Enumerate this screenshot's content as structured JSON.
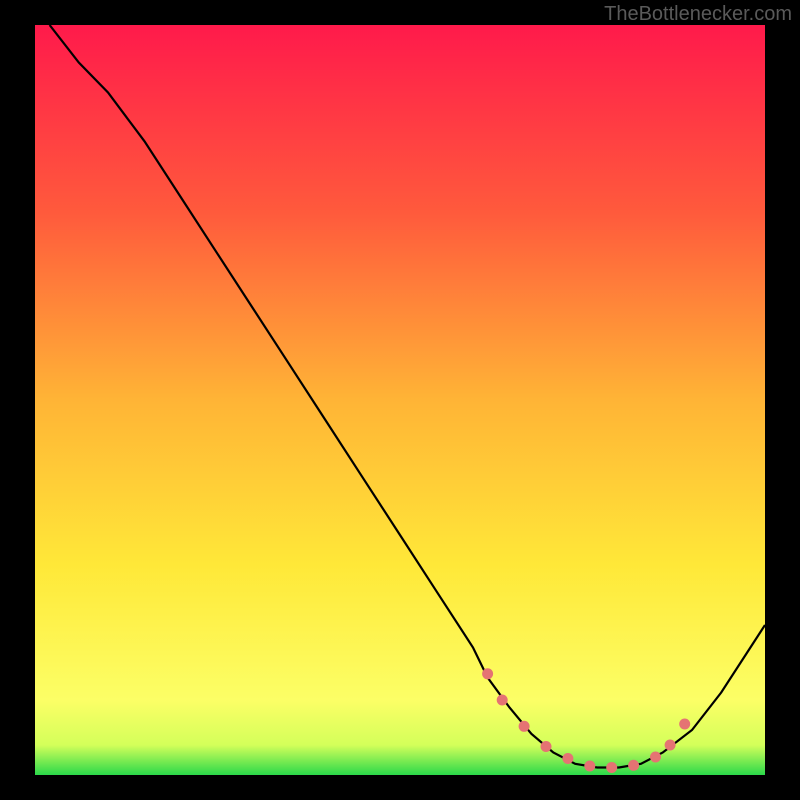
{
  "watermark": "TheBottlenecker.com",
  "chart_data": {
    "type": "line",
    "title": "",
    "xlabel": "",
    "ylabel": "",
    "xlim": [
      0,
      100
    ],
    "ylim": [
      0,
      100
    ],
    "series": [
      {
        "name": "curve",
        "color": "#000000",
        "x": [
          2,
          6,
          10,
          15,
          20,
          25,
          30,
          35,
          40,
          45,
          50,
          55,
          60,
          62,
          65,
          68,
          71,
          74,
          77,
          80,
          83,
          86,
          90,
          94,
          98,
          100
        ],
        "y": [
          100,
          95,
          91,
          84.5,
          77,
          69.5,
          62,
          54.5,
          47,
          39.5,
          32,
          24.5,
          17,
          13,
          9,
          5.5,
          3,
          1.5,
          1,
          1,
          1.5,
          3,
          6,
          11,
          17,
          20
        ]
      }
    ],
    "highlight": {
      "name": "dotted-trough",
      "color": "#e57373",
      "points_x": [
        62,
        64,
        67,
        70,
        73,
        76,
        79,
        82,
        85,
        87,
        89
      ],
      "points_y": [
        13.5,
        10,
        6.5,
        3.8,
        2.2,
        1.2,
        1,
        1.3,
        2.4,
        4,
        6.8
      ]
    },
    "gradient_stops": [
      {
        "offset": 0,
        "color": "#ff1a4b"
      },
      {
        "offset": 25,
        "color": "#ff5a3c"
      },
      {
        "offset": 50,
        "color": "#ffb436"
      },
      {
        "offset": 72,
        "color": "#ffe838"
      },
      {
        "offset": 90,
        "color": "#fcff66"
      },
      {
        "offset": 96,
        "color": "#d4ff5a"
      },
      {
        "offset": 100,
        "color": "#2bd94a"
      }
    ]
  }
}
